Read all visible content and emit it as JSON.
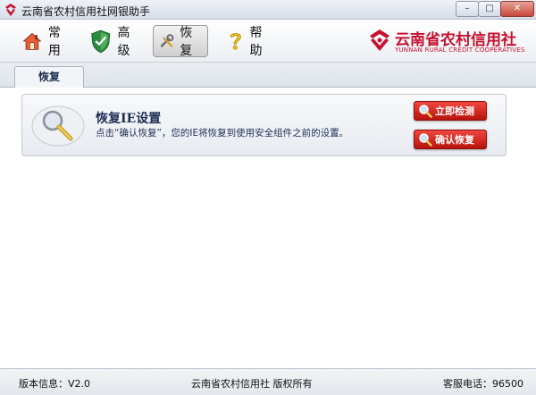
{
  "window": {
    "title": "云南省农村信用社网银助手",
    "minimize": "–",
    "maximize": "□",
    "close": "✕"
  },
  "toolbar": {
    "items": [
      {
        "label": "常用",
        "icon": "house-icon"
      },
      {
        "label": "高级",
        "icon": "shield-icon"
      },
      {
        "label": "恢复",
        "icon": "tools-icon"
      },
      {
        "label": "帮助",
        "icon": "question-icon"
      }
    ],
    "active_index": 2
  },
  "brand": {
    "name_cn": "云南省农村信用社",
    "name_en": "YUNNAN RURAL CREDIT COOPERATIVES",
    "color": "#c8102e"
  },
  "tabs": [
    {
      "label": "恢复",
      "active": true
    }
  ],
  "panel": {
    "title": "恢复IE设置",
    "description": "点击“确认恢复”，您的IE将恢复到使用安全组件之前的设置。",
    "icon": "magnifier-icon",
    "buttons": {
      "detect": "立即检测",
      "confirm": "确认恢复"
    }
  },
  "status": {
    "version": "版本信息：V2.0",
    "copyright": "云南省农村信用社  版权所有",
    "phone": "客服电话：96500"
  },
  "colors": {
    "accent_red": "#c8102e",
    "button_red": "#d6261f",
    "title_blue": "#1e2f55"
  }
}
